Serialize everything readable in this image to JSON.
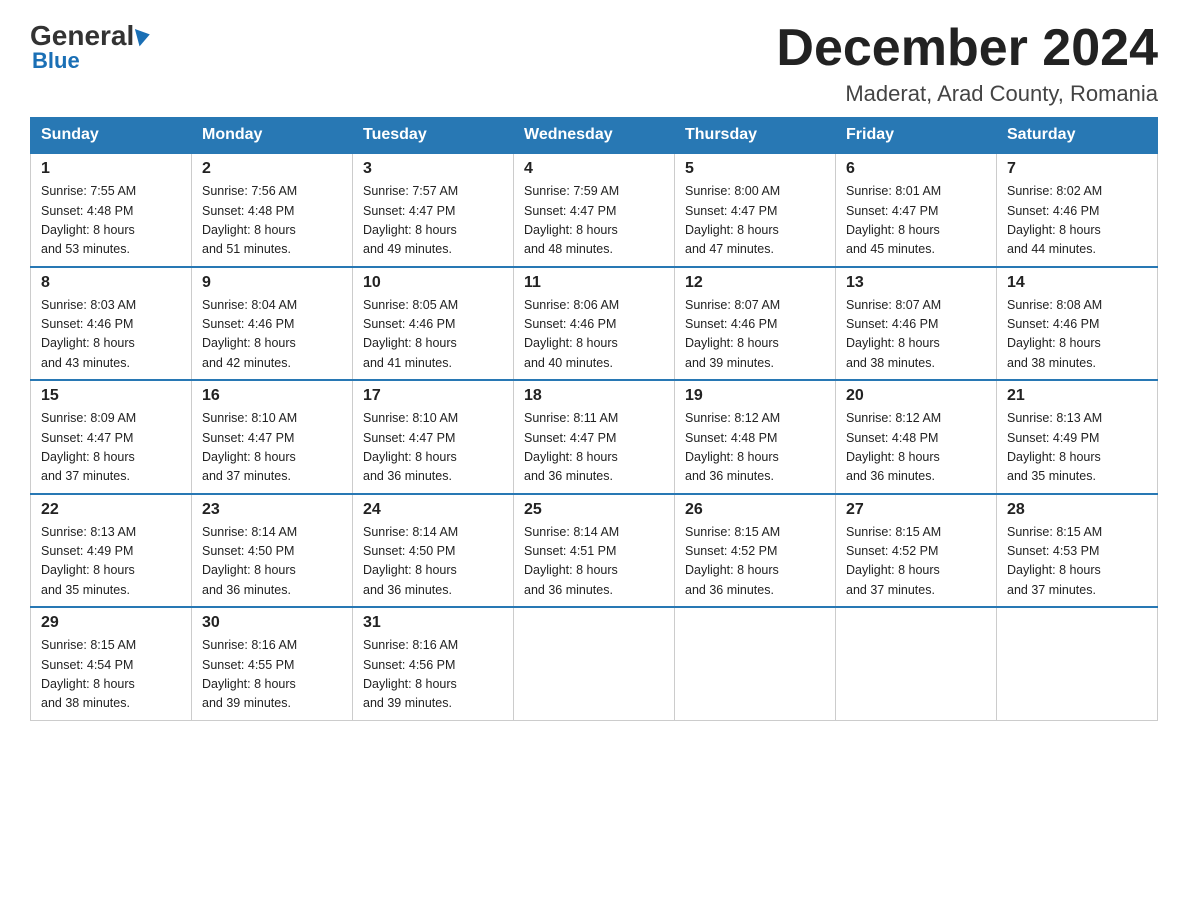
{
  "logo": {
    "general": "General",
    "arrow": "",
    "blue": "Blue"
  },
  "title": "December 2024",
  "subtitle": "Maderat, Arad County, Romania",
  "weekdays": [
    "Sunday",
    "Monday",
    "Tuesday",
    "Wednesday",
    "Thursday",
    "Friday",
    "Saturday"
  ],
  "weeks": [
    [
      {
        "day": "1",
        "sunrise": "7:55 AM",
        "sunset": "4:48 PM",
        "daylight": "8 hours and 53 minutes."
      },
      {
        "day": "2",
        "sunrise": "7:56 AM",
        "sunset": "4:48 PM",
        "daylight": "8 hours and 51 minutes."
      },
      {
        "day": "3",
        "sunrise": "7:57 AM",
        "sunset": "4:47 PM",
        "daylight": "8 hours and 49 minutes."
      },
      {
        "day": "4",
        "sunrise": "7:59 AM",
        "sunset": "4:47 PM",
        "daylight": "8 hours and 48 minutes."
      },
      {
        "day": "5",
        "sunrise": "8:00 AM",
        "sunset": "4:47 PM",
        "daylight": "8 hours and 47 minutes."
      },
      {
        "day": "6",
        "sunrise": "8:01 AM",
        "sunset": "4:47 PM",
        "daylight": "8 hours and 45 minutes."
      },
      {
        "day": "7",
        "sunrise": "8:02 AM",
        "sunset": "4:46 PM",
        "daylight": "8 hours and 44 minutes."
      }
    ],
    [
      {
        "day": "8",
        "sunrise": "8:03 AM",
        "sunset": "4:46 PM",
        "daylight": "8 hours and 43 minutes."
      },
      {
        "day": "9",
        "sunrise": "8:04 AM",
        "sunset": "4:46 PM",
        "daylight": "8 hours and 42 minutes."
      },
      {
        "day": "10",
        "sunrise": "8:05 AM",
        "sunset": "4:46 PM",
        "daylight": "8 hours and 41 minutes."
      },
      {
        "day": "11",
        "sunrise": "8:06 AM",
        "sunset": "4:46 PM",
        "daylight": "8 hours and 40 minutes."
      },
      {
        "day": "12",
        "sunrise": "8:07 AM",
        "sunset": "4:46 PM",
        "daylight": "8 hours and 39 minutes."
      },
      {
        "day": "13",
        "sunrise": "8:07 AM",
        "sunset": "4:46 PM",
        "daylight": "8 hours and 38 minutes."
      },
      {
        "day": "14",
        "sunrise": "8:08 AM",
        "sunset": "4:46 PM",
        "daylight": "8 hours and 38 minutes."
      }
    ],
    [
      {
        "day": "15",
        "sunrise": "8:09 AM",
        "sunset": "4:47 PM",
        "daylight": "8 hours and 37 minutes."
      },
      {
        "day": "16",
        "sunrise": "8:10 AM",
        "sunset": "4:47 PM",
        "daylight": "8 hours and 37 minutes."
      },
      {
        "day": "17",
        "sunrise": "8:10 AM",
        "sunset": "4:47 PM",
        "daylight": "8 hours and 36 minutes."
      },
      {
        "day": "18",
        "sunrise": "8:11 AM",
        "sunset": "4:47 PM",
        "daylight": "8 hours and 36 minutes."
      },
      {
        "day": "19",
        "sunrise": "8:12 AM",
        "sunset": "4:48 PM",
        "daylight": "8 hours and 36 minutes."
      },
      {
        "day": "20",
        "sunrise": "8:12 AM",
        "sunset": "4:48 PM",
        "daylight": "8 hours and 36 minutes."
      },
      {
        "day": "21",
        "sunrise": "8:13 AM",
        "sunset": "4:49 PM",
        "daylight": "8 hours and 35 minutes."
      }
    ],
    [
      {
        "day": "22",
        "sunrise": "8:13 AM",
        "sunset": "4:49 PM",
        "daylight": "8 hours and 35 minutes."
      },
      {
        "day": "23",
        "sunrise": "8:14 AM",
        "sunset": "4:50 PM",
        "daylight": "8 hours and 36 minutes."
      },
      {
        "day": "24",
        "sunrise": "8:14 AM",
        "sunset": "4:50 PM",
        "daylight": "8 hours and 36 minutes."
      },
      {
        "day": "25",
        "sunrise": "8:14 AM",
        "sunset": "4:51 PM",
        "daylight": "8 hours and 36 minutes."
      },
      {
        "day": "26",
        "sunrise": "8:15 AM",
        "sunset": "4:52 PM",
        "daylight": "8 hours and 36 minutes."
      },
      {
        "day": "27",
        "sunrise": "8:15 AM",
        "sunset": "4:52 PM",
        "daylight": "8 hours and 37 minutes."
      },
      {
        "day": "28",
        "sunrise": "8:15 AM",
        "sunset": "4:53 PM",
        "daylight": "8 hours and 37 minutes."
      }
    ],
    [
      {
        "day": "29",
        "sunrise": "8:15 AM",
        "sunset": "4:54 PM",
        "daylight": "8 hours and 38 minutes."
      },
      {
        "day": "30",
        "sunrise": "8:16 AM",
        "sunset": "4:55 PM",
        "daylight": "8 hours and 39 minutes."
      },
      {
        "day": "31",
        "sunrise": "8:16 AM",
        "sunset": "4:56 PM",
        "daylight": "8 hours and 39 minutes."
      },
      null,
      null,
      null,
      null
    ]
  ],
  "labels": {
    "sunrise": "Sunrise: ",
    "sunset": "Sunset: ",
    "daylight": "Daylight: "
  }
}
